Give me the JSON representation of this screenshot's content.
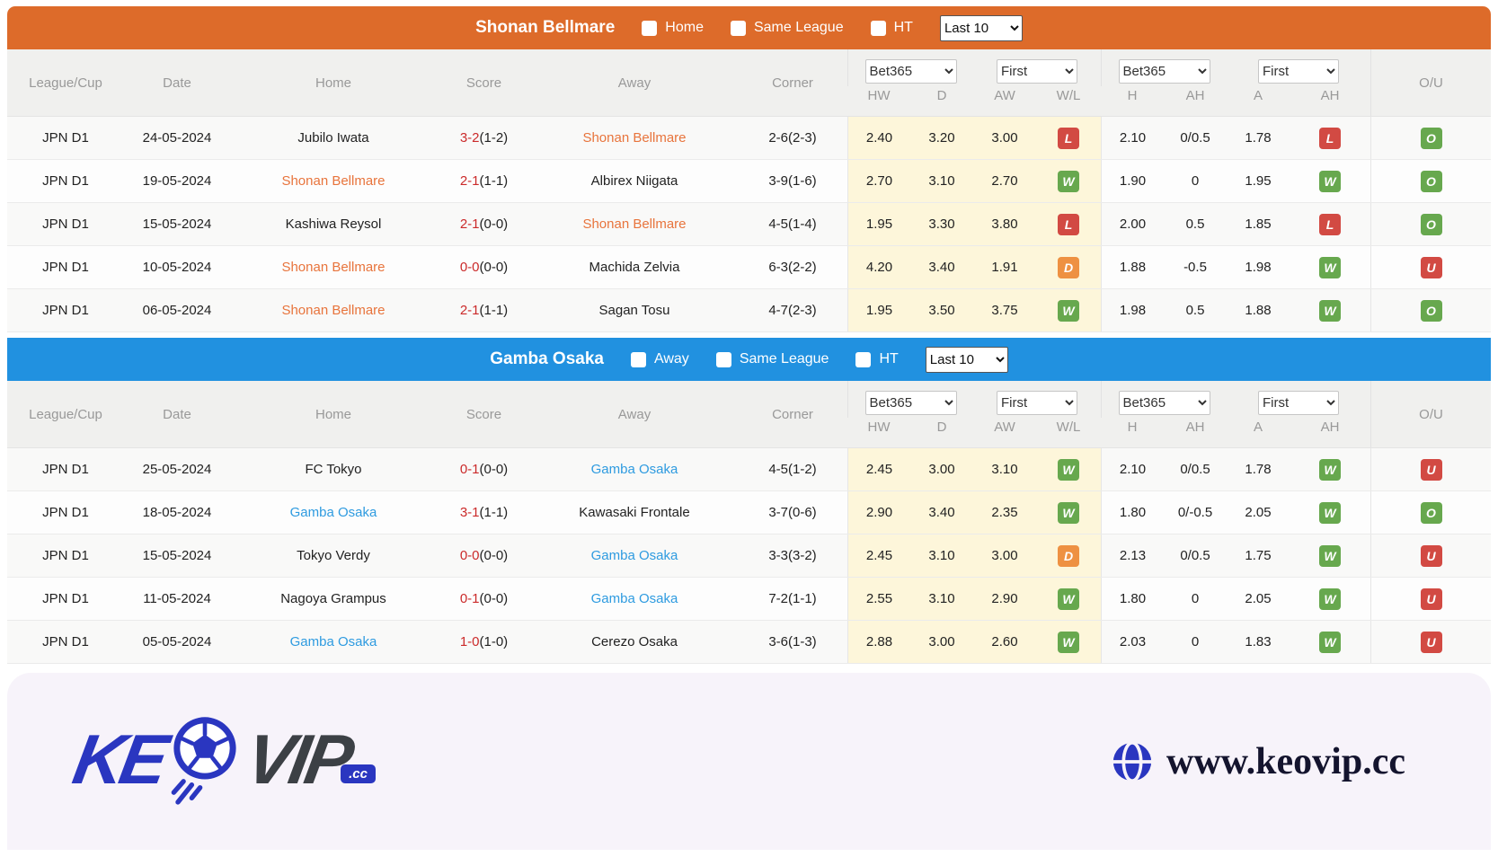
{
  "section1": {
    "title": "Shonan Bellmare",
    "filters": [
      "Home",
      "Same League",
      "HT"
    ],
    "range_select": "Last 10",
    "accent": "#dd6b2a"
  },
  "section2": {
    "title": "Gamba Osaka",
    "filters": [
      "Away",
      "Same League",
      "HT"
    ],
    "range_select": "Last 10",
    "accent": "#2191e0"
  },
  "columns": {
    "league": "League/Cup",
    "date": "Date",
    "home": "Home",
    "score": "Score",
    "away": "Away",
    "corner": "Corner",
    "bookmaker_select": "Bet365",
    "period_select": "First",
    "hw": "HW",
    "d": "D",
    "aw": "AW",
    "wl": "W/L",
    "h": "H",
    "ah": "AH",
    "a": "A",
    "ah2": "AH",
    "ou": "O/U"
  },
  "table1": {
    "rows": [
      {
        "league": "JPN D1",
        "date": "24-05-2024",
        "home": "Jubilo Iwata",
        "score_ft": "3-2",
        "score_ht": "(1-2)",
        "away": "Shonan Bellmare",
        "away_hl": true,
        "corner": "2-6(2-3)",
        "hw": "2.40",
        "d": "3.20",
        "aw": "3.00",
        "wl": "L",
        "h": "2.10",
        "ah": "0/0.5",
        "a": "1.78",
        "ah_wl": "L",
        "ou": "O"
      },
      {
        "league": "JPN D1",
        "date": "19-05-2024",
        "home": "Shonan Bellmare",
        "home_hl": true,
        "score_ft": "2-1",
        "score_ht": "(1-1)",
        "away": "Albirex Niigata",
        "corner": "3-9(1-6)",
        "hw": "2.70",
        "d": "3.10",
        "aw": "2.70",
        "wl": "W",
        "h": "1.90",
        "ah": "0",
        "a": "1.95",
        "ah_wl": "W",
        "ou": "O"
      },
      {
        "league": "JPN D1",
        "date": "15-05-2024",
        "home": "Kashiwa Reysol",
        "score_ft": "2-1",
        "score_ht": "(0-0)",
        "away": "Shonan Bellmare",
        "away_hl": true,
        "corner": "4-5(1-4)",
        "hw": "1.95",
        "d": "3.30",
        "aw": "3.80",
        "wl": "L",
        "h": "2.00",
        "ah": "0.5",
        "a": "1.85",
        "ah_wl": "L",
        "ou": "O"
      },
      {
        "league": "JPN D1",
        "date": "10-05-2024",
        "home": "Shonan Bellmare",
        "home_hl": true,
        "score_ft": "0-0",
        "score_ht": "(0-0)",
        "away": "Machida Zelvia",
        "corner": "6-3(2-2)",
        "hw": "4.20",
        "d": "3.40",
        "aw": "1.91",
        "wl": "D",
        "h": "1.88",
        "ah": "-0.5",
        "a": "1.98",
        "ah_wl": "W",
        "ou": "U"
      },
      {
        "league": "JPN D1",
        "date": "06-05-2024",
        "home": "Shonan Bellmare",
        "home_hl": true,
        "score_ft": "2-1",
        "score_ht": "(1-1)",
        "away": "Sagan Tosu",
        "corner": "4-7(2-3)",
        "hw": "1.95",
        "d": "3.50",
        "aw": "3.75",
        "wl": "W",
        "h": "1.98",
        "ah": "0.5",
        "a": "1.88",
        "ah_wl": "W",
        "ou": "O"
      }
    ]
  },
  "table2": {
    "rows": [
      {
        "league": "JPN D1",
        "date": "25-05-2024",
        "home": "FC Tokyo",
        "score_ft": "0-1",
        "score_ht": "(0-0)",
        "away": "Gamba Osaka",
        "away_hl": true,
        "corner": "4-5(1-2)",
        "hw": "2.45",
        "d": "3.00",
        "aw": "3.10",
        "wl": "W",
        "h": "2.10",
        "ah": "0/0.5",
        "a": "1.78",
        "ah_wl": "W",
        "ou": "U"
      },
      {
        "league": "JPN D1",
        "date": "18-05-2024",
        "home": "Gamba Osaka",
        "home_hl": true,
        "score_ft": "3-1",
        "score_ht": "(1-1)",
        "away": "Kawasaki Frontale",
        "corner": "3-7(0-6)",
        "hw": "2.90",
        "d": "3.40",
        "aw": "2.35",
        "wl": "W",
        "h": "1.80",
        "ah": "0/-0.5",
        "a": "2.05",
        "ah_wl": "W",
        "ou": "O"
      },
      {
        "league": "JPN D1",
        "date": "15-05-2024",
        "home": "Tokyo Verdy",
        "score_ft": "0-0",
        "score_ht": "(0-0)",
        "away": "Gamba Osaka",
        "away_hl": true,
        "corner": "3-3(3-2)",
        "hw": "2.45",
        "d": "3.10",
        "aw": "3.00",
        "wl": "D",
        "h": "2.13",
        "ah": "0/0.5",
        "a": "1.75",
        "ah_wl": "W",
        "ou": "U"
      },
      {
        "league": "JPN D1",
        "date": "11-05-2024",
        "home": "Nagoya Grampus",
        "score_ft": "0-1",
        "score_ht": "(0-0)",
        "away": "Gamba Osaka",
        "away_hl": true,
        "corner": "7-2(1-1)",
        "hw": "2.55",
        "d": "3.10",
        "aw": "2.90",
        "wl": "W",
        "h": "1.80",
        "ah": "0",
        "a": "2.05",
        "ah_wl": "W",
        "ou": "U"
      },
      {
        "league": "JPN D1",
        "date": "05-05-2024",
        "home": "Gamba Osaka",
        "home_hl": true,
        "score_ft": "1-0",
        "score_ht": "(1-0)",
        "away": "Cerezo Osaka",
        "corner": "3-6(1-3)",
        "hw": "2.88",
        "d": "3.00",
        "aw": "2.60",
        "wl": "W",
        "h": "2.03",
        "ah": "0",
        "a": "1.83",
        "ah_wl": "W",
        "ou": "U"
      }
    ]
  },
  "footer": {
    "logo_left": "KE",
    "logo_right": "VIP",
    "logo_suffix": ".cc",
    "url": "www.keovip.cc",
    "logo_blue": "#2a36c0"
  }
}
